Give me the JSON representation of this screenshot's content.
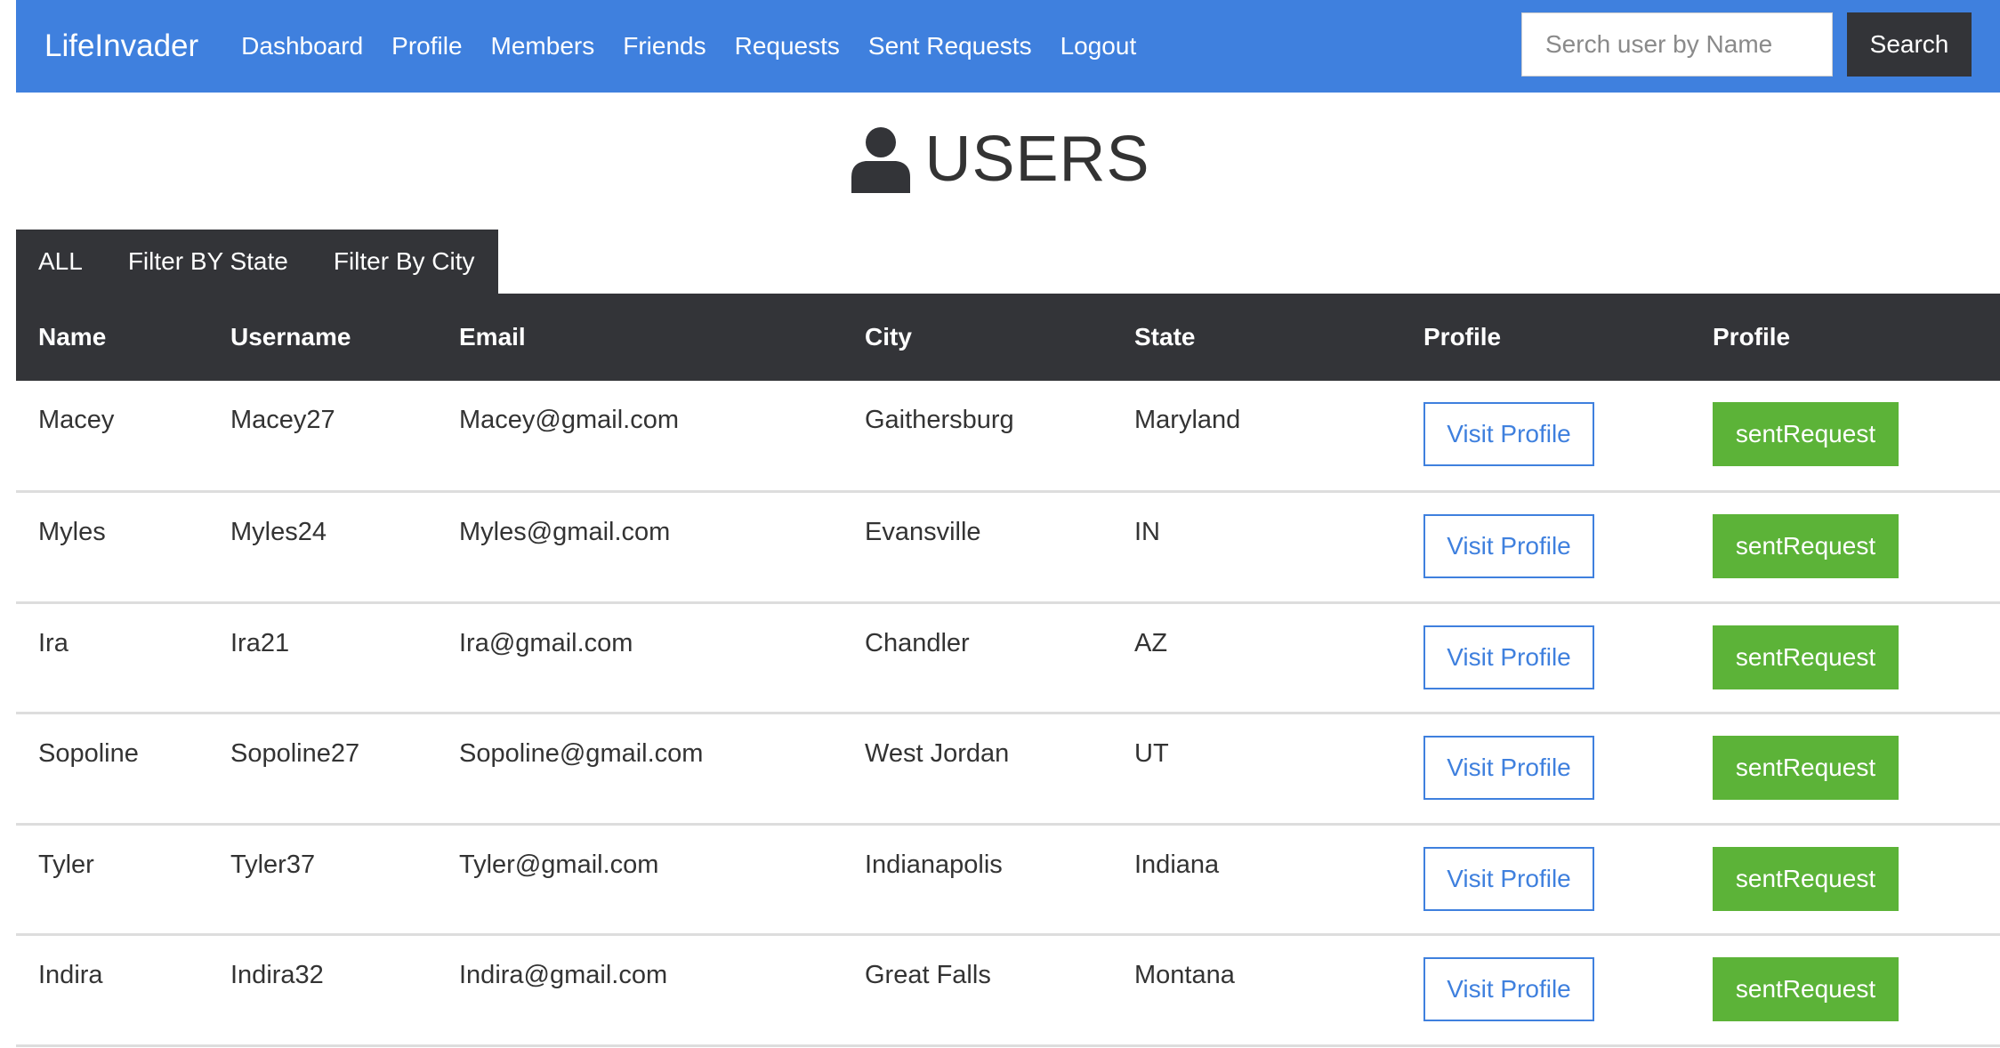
{
  "navbar": {
    "brand": "LifeInvader",
    "links": [
      "Dashboard",
      "Profile",
      "Members",
      "Friends",
      "Requests",
      "Sent Requests",
      "Logout"
    ],
    "search_placeholder": "Serch user by Name",
    "search_label": "Search",
    "background": "#3f80de"
  },
  "heading": {
    "icon": "user-icon",
    "title": "USERS"
  },
  "filters": [
    "ALL",
    "Filter BY State",
    "Filter By City"
  ],
  "table": {
    "columns": [
      "Name",
      "Username",
      "Email",
      "City",
      "State",
      "Profile",
      "Profile"
    ],
    "rows": [
      {
        "name": "Macey",
        "username": "Macey27",
        "email": "Macey@gmail.com",
        "city": "Gaithersburg",
        "state": "Maryland",
        "visit": "Visit Profile",
        "request": "sentRequest"
      },
      {
        "name": "Myles",
        "username": "Myles24",
        "email": "Myles@gmail.com",
        "city": "Evansville",
        "state": "IN",
        "visit": "Visit Profile",
        "request": "sentRequest"
      },
      {
        "name": "Ira",
        "username": "Ira21",
        "email": "Ira@gmail.com",
        "city": "Chandler",
        "state": "AZ",
        "visit": "Visit Profile",
        "request": "sentRequest"
      },
      {
        "name": "Sopoline",
        "username": "Sopoline27",
        "email": "Sopoline@gmail.com",
        "city": "West Jordan",
        "state": "UT",
        "visit": "Visit Profile",
        "request": "sentRequest"
      },
      {
        "name": "Tyler",
        "username": "Tyler37",
        "email": "Tyler@gmail.com",
        "city": "Indianapolis",
        "state": "Indiana",
        "visit": "Visit Profile",
        "request": "sentRequest"
      },
      {
        "name": "Indira",
        "username": "Indira32",
        "email": "Indira@gmail.com",
        "city": "Great Falls",
        "state": "Montana",
        "visit": "Visit Profile",
        "request": "sentRequest"
      }
    ]
  },
  "colors": {
    "primary": "#3f80de",
    "dark": "#333438",
    "success": "#5cb338",
    "divider": "#dddddd"
  }
}
